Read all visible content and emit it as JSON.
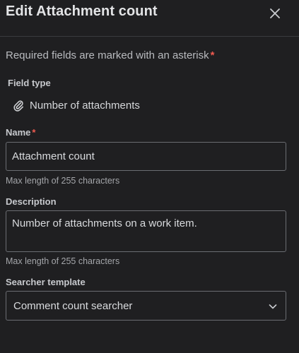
{
  "header": {
    "title": "Edit Attachment count"
  },
  "required_note": {
    "text": "Required fields are marked with an asterisk",
    "asterisk": "*"
  },
  "field_type": {
    "label": "Field type",
    "value": "Number of attachments",
    "icon": "paperclip-icon"
  },
  "name": {
    "label": "Name",
    "required_marker": "*",
    "value": "Attachment count",
    "hint": "Max length of 255 characters"
  },
  "description": {
    "label": "Description",
    "value": "Number of attachments on a work item.",
    "hint": "Max length of 255 characters"
  },
  "searcher": {
    "label": "Searcher template",
    "selected": "Comment count searcher",
    "icon": "chevron-down-icon"
  },
  "colors": {
    "background": "#1f1f21",
    "required_asterisk": "#f15b50",
    "input_border": "#6b6d72"
  }
}
